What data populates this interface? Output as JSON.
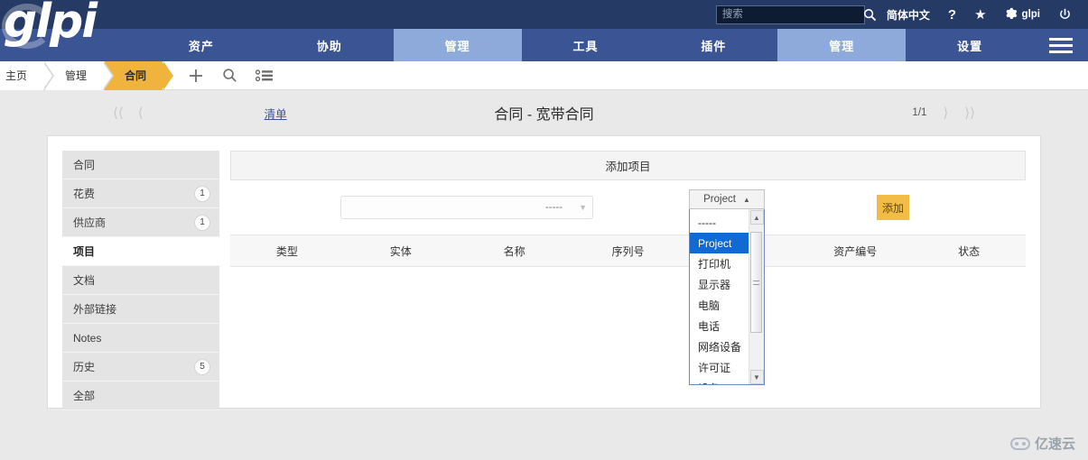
{
  "topbar": {
    "logo": "glpi",
    "search_placeholder": "搜索",
    "search_value": "",
    "search_icon": "search-icon",
    "language": "简体中文",
    "help": "?",
    "favorite": "★",
    "user": "glpi",
    "power": "⏻"
  },
  "mainnav": {
    "items": [
      {
        "label": "资产",
        "active": false
      },
      {
        "label": "协助",
        "active": false
      },
      {
        "label": "管理",
        "active": true
      },
      {
        "label": "工具",
        "active": false
      },
      {
        "label": "插件",
        "active": false
      },
      {
        "label": "管理",
        "active": true
      },
      {
        "label": "设置",
        "active": false
      }
    ]
  },
  "breadcrumb": {
    "items": [
      {
        "label": "主页",
        "active": false
      },
      {
        "label": "管理",
        "active": false
      },
      {
        "label": "合同",
        "active": true
      }
    ],
    "icons": [
      "plus-icon",
      "search-icon",
      "list-icon"
    ]
  },
  "titlerow": {
    "first_label": "⟨⟨",
    "prev_label": "⟨",
    "list_link": "清单",
    "title": "合同 - 宽带合同",
    "page_count": "1/1",
    "next_label": "⟩",
    "last_label": "⟩⟩"
  },
  "sidetabs": {
    "items": [
      {
        "label": "合同",
        "badge": "",
        "active": false
      },
      {
        "label": "花费",
        "badge": "1",
        "active": false
      },
      {
        "label": "供应商",
        "badge": "1",
        "active": false
      },
      {
        "label": "项目",
        "badge": "",
        "active": true
      },
      {
        "label": "文档",
        "badge": "",
        "active": false
      },
      {
        "label": "外部链接",
        "badge": "",
        "active": false
      },
      {
        "label": "Notes",
        "badge": "",
        "active": false
      },
      {
        "label": "历史",
        "badge": "5",
        "active": false
      },
      {
        "label": "全部",
        "badge": "",
        "active": false
      }
    ]
  },
  "panel": {
    "header": "添加项目",
    "select_value": "-----",
    "select_caret": "▼",
    "add_button": "添加",
    "table_headers": [
      "类型",
      "实体",
      "名称",
      "序列号",
      "",
      "资产编号",
      "状态"
    ]
  },
  "dropdown": {
    "selected": "Project",
    "closed_caret": "▲",
    "scroll_up": "▲",
    "scroll_down": "▼",
    "options": [
      {
        "label": "-----",
        "selected": false
      },
      {
        "label": "Project",
        "selected": true
      },
      {
        "label": "打印机",
        "selected": false
      },
      {
        "label": "显示器",
        "selected": false
      },
      {
        "label": "电脑",
        "selected": false
      },
      {
        "label": "电话",
        "selected": false
      },
      {
        "label": "网络设备",
        "selected": false
      },
      {
        "label": "许可证",
        "selected": false
      },
      {
        "label": "设备",
        "selected": false
      }
    ]
  },
  "watermark": {
    "text": "亿速云"
  },
  "colors": {
    "topbar": "#263a66",
    "navbar": "#3b5494",
    "nav_active": "#8eaada",
    "crumb_active": "#f0b43c",
    "add_button": "#f2bc47",
    "dropdown_selected": "#1169d4"
  }
}
